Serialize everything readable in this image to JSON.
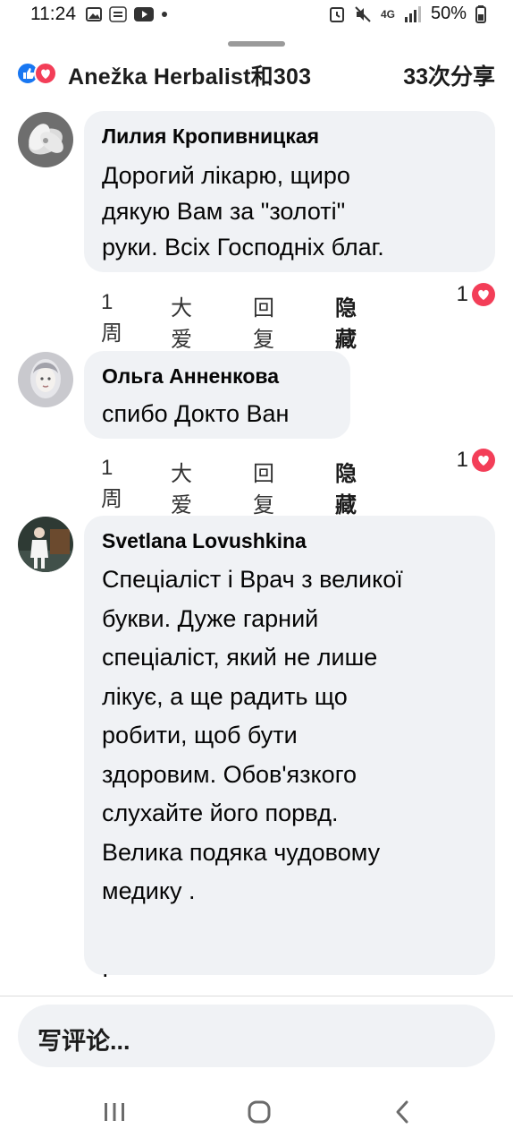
{
  "status_bar": {
    "time": "11:24",
    "network": "4G",
    "battery": "50%",
    "icons_left": [
      "gallery-icon",
      "temu-icon",
      "youtube-icon",
      "dot-icon"
    ],
    "icons_right": [
      "alarm-icon",
      "mute-icon",
      "signal-icon",
      "battery-icon"
    ]
  },
  "header": {
    "reactions": [
      "like-icon",
      "love-icon"
    ],
    "names": "Anežka Herbalist和303",
    "shares": "33次分享"
  },
  "colors": {
    "accent_like": "#1877f2",
    "accent_love": "#f33e58",
    "bubble_bg": "#f0f2f5"
  },
  "comments": [
    {
      "author": "Лилия Кропивницкая",
      "text": "Дорогий лікарю, щиро\nдякую Вам за \"золоті\"\nруки. Всіх Господніх благ.",
      "time": "1周",
      "love_label": "大爱",
      "reply_label": "回复",
      "hide_label": "隐藏",
      "reaction_count": "1"
    },
    {
      "author": "Ольга Анненкова",
      "text": "спибо Докто Ван",
      "time": "1周",
      "love_label": "大爱",
      "reply_label": "回复",
      "hide_label": "隐藏",
      "reaction_count": "1"
    },
    {
      "author": "Svetlana Lovushkina",
      "text": "Спеціаліст і Врач з великої\nбукви. Дуже гарний\nспеціаліст, який не лише\nлікує, а ще радить що\nробити, щоб бути\nздоровим. Обов'язкого\nслухайте його порвд.\nВелика подяка чудовому\nмедику .\n\n."
    }
  ],
  "composer": {
    "placeholder": "写评论..."
  },
  "nav": [
    "recent-apps-icon",
    "home-icon",
    "back-icon"
  ]
}
